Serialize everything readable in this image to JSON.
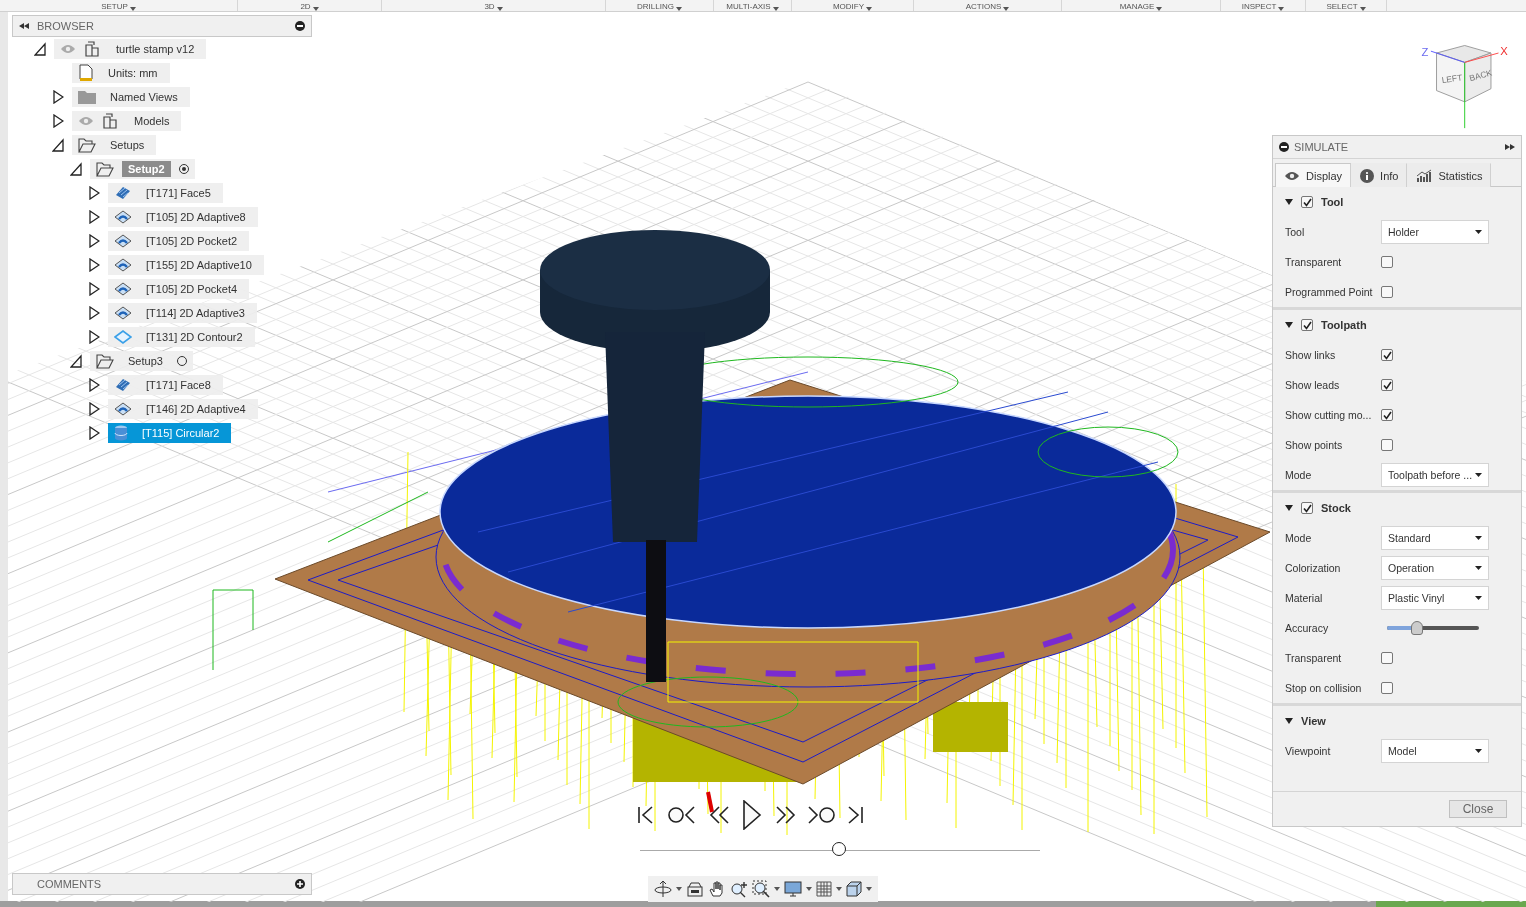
{
  "toolbar": [
    "SETUP",
    "2D",
    "3D",
    "DRILLING",
    "MULTI-AXIS",
    "MODIFY",
    "ACTIONS",
    "MANAGE",
    "INSPECT",
    "SELECT"
  ],
  "browser": {
    "title": "BROWSER",
    "tree": [
      {
        "label": "turtle stamp v12",
        "kind": "component",
        "visible": true,
        "expanded": true,
        "selected": false,
        "children": [
          {
            "label": "Units: mm",
            "kind": "units",
            "selected": false
          },
          {
            "label": "Named Views",
            "kind": "folder",
            "expanded": false,
            "selected": false
          },
          {
            "label": "Models",
            "kind": "component",
            "visible": true,
            "expanded": false,
            "selected": false
          },
          {
            "label": "Setups",
            "kind": "setups",
            "expanded": true,
            "selected": false,
            "children": [
              {
                "label": "Setup2",
                "kind": "setup",
                "expanded": true,
                "active": true,
                "selected": false,
                "children": [
                  {
                    "label": "[T171] Face5",
                    "kind": "face",
                    "expanded": false,
                    "selected": false
                  },
                  {
                    "label": "[T105] 2D Adaptive8",
                    "kind": "adaptive",
                    "expanded": false,
                    "selected": false
                  },
                  {
                    "label": "[T105] 2D Pocket2",
                    "kind": "adaptive",
                    "expanded": false,
                    "selected": false
                  },
                  {
                    "label": "[T155] 2D Adaptive10",
                    "kind": "adaptive",
                    "expanded": false,
                    "selected": false
                  },
                  {
                    "label": "[T105] 2D Pocket4",
                    "kind": "adaptive",
                    "expanded": false,
                    "selected": false
                  },
                  {
                    "label": "[T114] 2D Adaptive3",
                    "kind": "adaptive",
                    "expanded": false,
                    "selected": false
                  },
                  {
                    "label": "[T131] 2D Contour2",
                    "kind": "contour",
                    "expanded": false,
                    "selected": false
                  }
                ]
              },
              {
                "label": "Setup3",
                "kind": "setup",
                "expanded": true,
                "active": false,
                "selected": false,
                "children": [
                  {
                    "label": "[T171] Face8",
                    "kind": "face",
                    "expanded": false,
                    "selected": false
                  },
                  {
                    "label": "[T146] 2D Adaptive4",
                    "kind": "adaptive",
                    "expanded": false,
                    "selected": false
                  },
                  {
                    "label": "[T115] Circular2",
                    "kind": "circular",
                    "expanded": false,
                    "selected": true
                  }
                ]
              }
            ]
          }
        ]
      }
    ]
  },
  "view_cube": {
    "faces": [
      "LEFT",
      "BACK"
    ],
    "axes": [
      "Z",
      "X"
    ]
  },
  "simulate": {
    "title": "SIMULATE",
    "tabs": [
      {
        "label": "Display",
        "kind": "display",
        "selected": true
      },
      {
        "label": "Info",
        "kind": "info",
        "selected": false
      },
      {
        "label": "Statistics",
        "kind": "statistics",
        "selected": false
      }
    ],
    "sections": [
      {
        "title": "Tool",
        "checked": true,
        "rows": [
          {
            "kind": "select",
            "label": "Tool",
            "value": "Holder"
          },
          {
            "kind": "checkbox",
            "label": "Transparent",
            "checked": false
          },
          {
            "kind": "checkbox",
            "label": "Programmed Point",
            "checked": false
          }
        ]
      },
      {
        "title": "Toolpath",
        "checked": true,
        "rows": [
          {
            "kind": "checkbox",
            "label": "Show links",
            "checked": true
          },
          {
            "kind": "checkbox",
            "label": "Show leads",
            "checked": true
          },
          {
            "kind": "checkbox",
            "label": "Show cutting mo...",
            "checked": true
          },
          {
            "kind": "checkbox",
            "label": "Show points",
            "checked": false
          },
          {
            "kind": "select",
            "label": "Mode",
            "value": "Toolpath before ..."
          }
        ]
      },
      {
        "title": "Stock",
        "checked": true,
        "rows": [
          {
            "kind": "select",
            "label": "Mode",
            "value": "Standard"
          },
          {
            "kind": "select",
            "label": "Colorization",
            "value": "Operation"
          },
          {
            "kind": "select",
            "label": "Material",
            "value": "Plastic Vinyl"
          },
          {
            "kind": "slider",
            "label": "Accuracy",
            "level": 0.33
          },
          {
            "kind": "checkbox",
            "label": "Transparent",
            "checked": false
          },
          {
            "kind": "checkbox",
            "label": "Stop on collision",
            "checked": false
          }
        ]
      },
      {
        "title": "View",
        "rows": [
          {
            "kind": "select",
            "label": "Viewpoint",
            "value": "Model"
          }
        ]
      }
    ],
    "close": "Close"
  },
  "playback": {
    "level": 0.5
  },
  "comments": {
    "title": "COMMENTS"
  }
}
